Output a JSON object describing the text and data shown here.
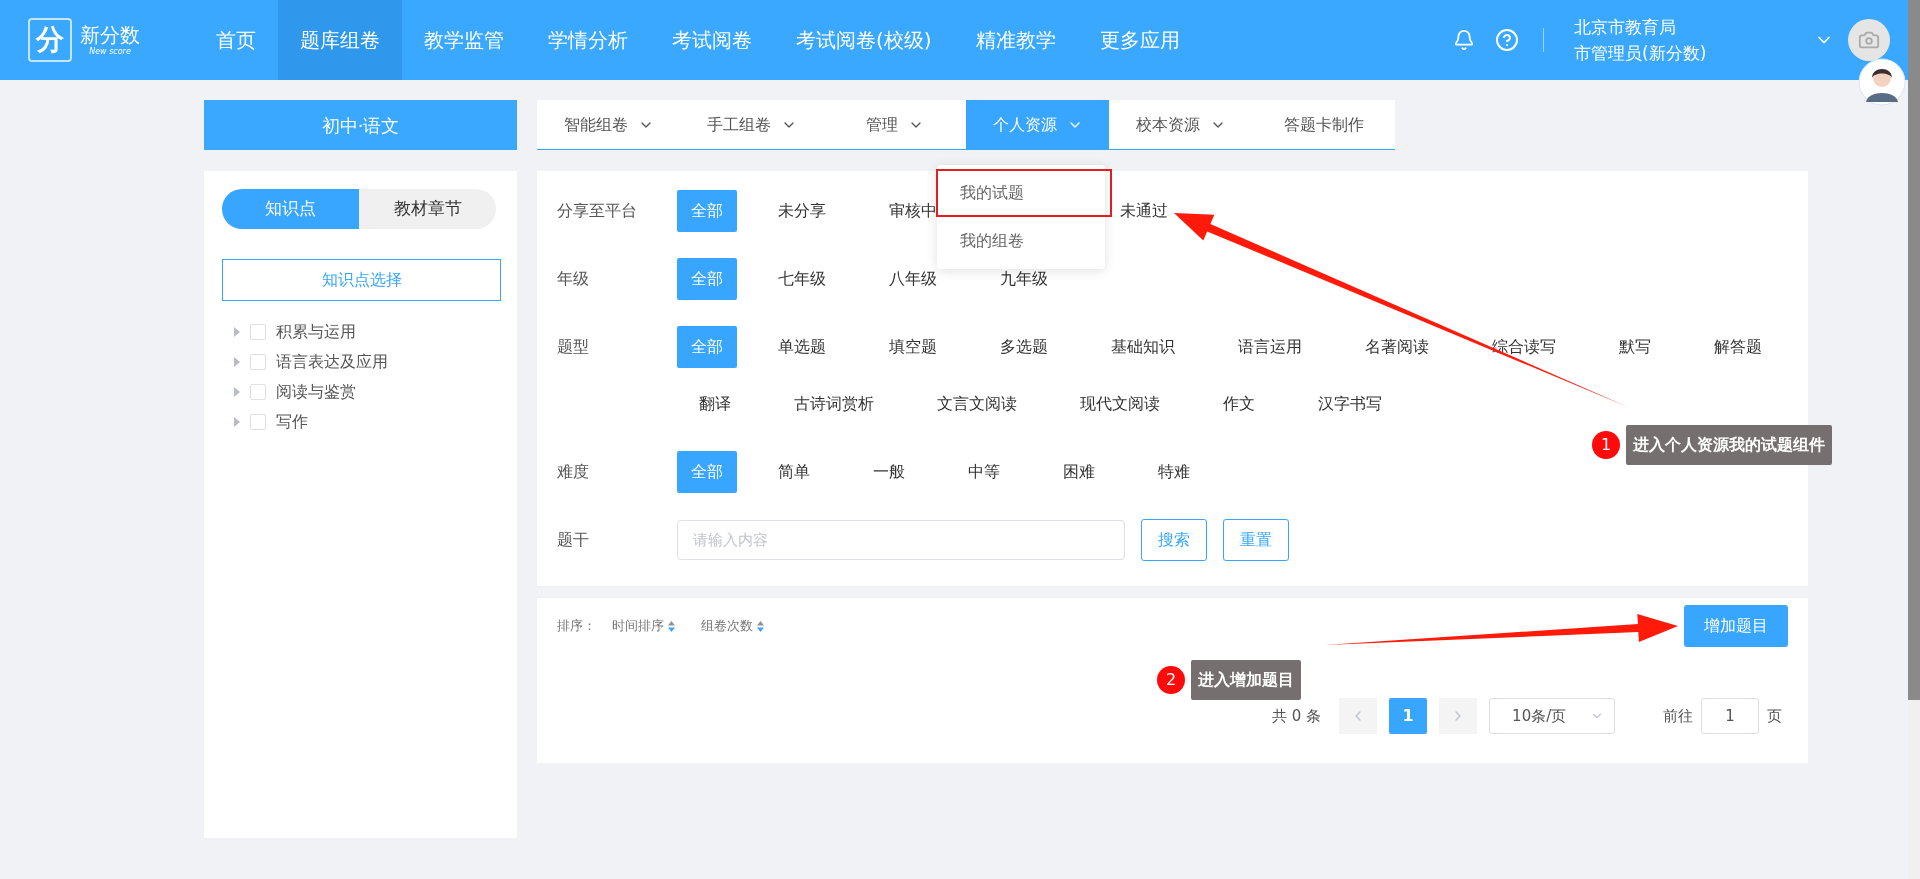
{
  "header": {
    "logo": {
      "mark": "分",
      "name": "新分数",
      "tagline": "New score"
    },
    "nav": [
      {
        "label": "首页",
        "selected": false
      },
      {
        "label": "题库组卷",
        "selected": true
      },
      {
        "label": "教学监管",
        "selected": false
      },
      {
        "label": "学情分析",
        "selected": false
      },
      {
        "label": "考试阅卷",
        "selected": false
      },
      {
        "label": "考试阅卷(校级)",
        "selected": false
      },
      {
        "label": "精准教学",
        "selected": false
      },
      {
        "label": "更多应用",
        "selected": false
      }
    ],
    "user": {
      "org": "北京市教育局",
      "role": "市管理员(新分数)"
    }
  },
  "subject": "初中·语文",
  "sidebar": {
    "tabs": [
      {
        "label": "知识点",
        "selected": true
      },
      {
        "label": "教材章节",
        "selected": false
      }
    ],
    "picker_button": "知识点选择",
    "tree": [
      {
        "label": "积累与运用",
        "checked": false,
        "expanded": false
      },
      {
        "label": "语言表达及应用",
        "checked": false,
        "expanded": false
      },
      {
        "label": "阅读与鉴赏",
        "checked": false,
        "expanded": false
      },
      {
        "label": "写作",
        "checked": false,
        "expanded": false
      }
    ]
  },
  "tabs": [
    {
      "label": "智能组卷",
      "has_menu": true,
      "selected": false
    },
    {
      "label": "手工组卷",
      "has_menu": true,
      "selected": false
    },
    {
      "label": "管理",
      "has_menu": true,
      "selected": false
    },
    {
      "label": "个人资源",
      "has_menu": true,
      "selected": true
    },
    {
      "label": "校本资源",
      "has_menu": true,
      "selected": false
    },
    {
      "label": "答题卡制作",
      "has_menu": false,
      "selected": false
    }
  ],
  "dropdown": {
    "items": [
      {
        "label": "我的试题",
        "highlighted": true
      },
      {
        "label": "我的组卷",
        "highlighted": false
      }
    ]
  },
  "filters": [
    {
      "label": "分享至平台",
      "options": [
        {
          "label": "全部",
          "selected": true
        },
        {
          "label": "未分享",
          "selected": false
        },
        {
          "label": "审核中",
          "selected": false
        },
        {
          "label": "未通过",
          "selected": false
        }
      ]
    },
    {
      "label": "年级",
      "options": [
        {
          "label": "全部",
          "selected": true
        },
        {
          "label": "七年级",
          "selected": false
        },
        {
          "label": "八年级",
          "selected": false
        },
        {
          "label": "九年级",
          "selected": false
        }
      ]
    },
    {
      "label": "题型",
      "options": [
        {
          "label": "全部",
          "selected": true
        },
        {
          "label": "单选题",
          "selected": false
        },
        {
          "label": "填空题",
          "selected": false
        },
        {
          "label": "多选题",
          "selected": false
        },
        {
          "label": "基础知识",
          "selected": false
        },
        {
          "label": "语言运用",
          "selected": false
        },
        {
          "label": "名著阅读",
          "selected": false
        },
        {
          "label": "综合读写",
          "selected": false
        },
        {
          "label": "默写",
          "selected": false
        },
        {
          "label": "解答题",
          "selected": false
        },
        {
          "label": "翻译",
          "selected": false
        },
        {
          "label": "古诗词赏析",
          "selected": false
        },
        {
          "label": "文言文阅读",
          "selected": false
        },
        {
          "label": "现代文阅读",
          "selected": false
        },
        {
          "label": "作文",
          "selected": false
        },
        {
          "label": "汉字书写",
          "selected": false
        }
      ]
    },
    {
      "label": "难度",
      "options": [
        {
          "label": "全部",
          "selected": true
        },
        {
          "label": "简单",
          "selected": false
        },
        {
          "label": "一般",
          "selected": false
        },
        {
          "label": "中等",
          "selected": false
        },
        {
          "label": "困难",
          "selected": false
        },
        {
          "label": "特难",
          "selected": false
        }
      ]
    }
  ],
  "stem_search": {
    "label": "题干",
    "placeholder": "请输入内容",
    "buttons": [
      "搜索",
      "重置"
    ]
  },
  "list": {
    "sort_label": "排序：",
    "sort_options": [
      "时间排序",
      "组卷次数"
    ],
    "add_button": "增加题目",
    "pagination": {
      "total": "共 0 条",
      "pages": [
        {
          "label": "1",
          "selected": true
        }
      ],
      "page_size": "10条/页",
      "goto_label": "前往",
      "goto_value": "1",
      "page_unit": "页"
    }
  },
  "annotations": [
    {
      "number": "1",
      "text": "进入个人资源我的试题组件"
    },
    {
      "number": "2",
      "text": "进入增加题目"
    }
  ]
}
